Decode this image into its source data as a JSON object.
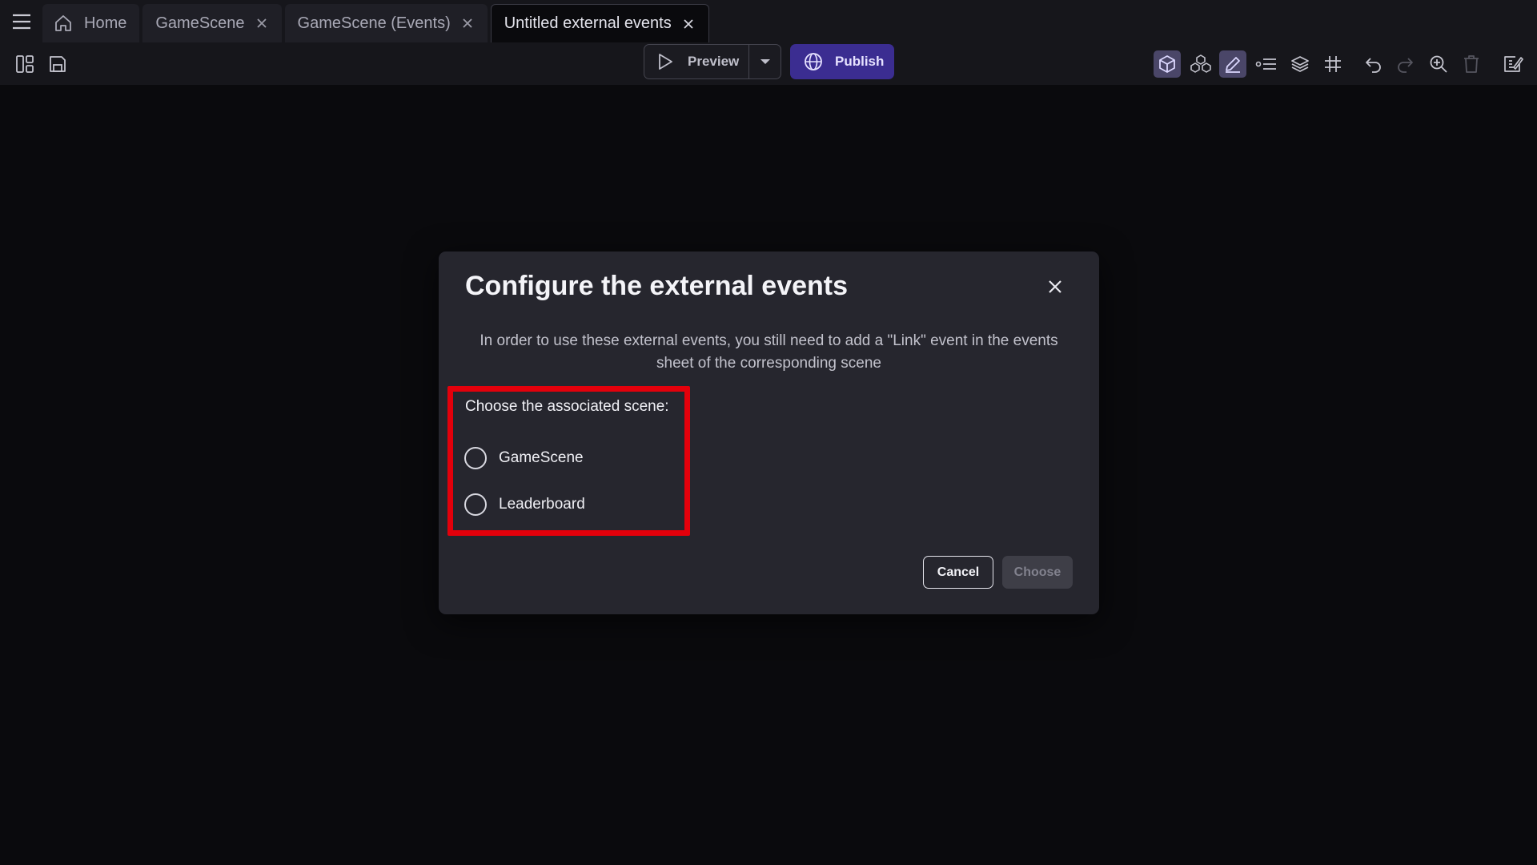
{
  "tabs": [
    {
      "label": "Home",
      "icon": "home-icon",
      "closable": false
    },
    {
      "label": "GameScene",
      "closable": true
    },
    {
      "label": "GameScene (Events)",
      "closable": true
    },
    {
      "label": "Untitled external events",
      "closable": true,
      "active": true
    }
  ],
  "toolbar": {
    "preview_label": "Preview",
    "publish_label": "Publish",
    "left_icons": [
      "panels-icon",
      "save-icon"
    ],
    "right_icons": [
      "cube-icon",
      "objects-group-icon",
      "edit-icon",
      "properties-list-icon",
      "layers-icon",
      "grid-icon",
      "undo-icon",
      "redo-icon",
      "zoom-icon",
      "delete-icon",
      "edit-scene-icon"
    ],
    "accent_color": "#3b2d91"
  },
  "dialog": {
    "title": "Configure the external events",
    "description": "In order to use these external events, you still need to add a \"Link\" event in the events sheet of the corresponding scene",
    "choose_label": "Choose the associated scene:",
    "scenes": [
      "GameScene",
      "Leaderboard"
    ],
    "selected_scene": null,
    "cancel_label": "Cancel",
    "choose_button_label": "Choose",
    "highlight_color": "#e3000b"
  }
}
